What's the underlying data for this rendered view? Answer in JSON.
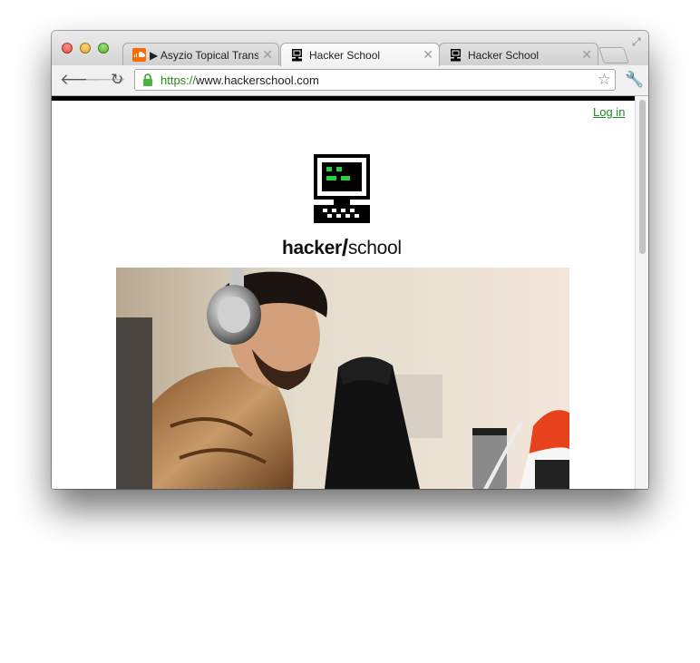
{
  "browser": {
    "tabs": [
      {
        "title": "Asyzio Topical Transl",
        "favicon": "soundcloud-icon",
        "playing": "▶",
        "active": false
      },
      {
        "title": "Hacker School",
        "favicon": "hacker-school-favicon",
        "active": true
      },
      {
        "title": "Hacker School",
        "favicon": "hacker-school-favicon",
        "active": false
      }
    ],
    "url_scheme": "https://",
    "url_host": "www.hackerschool.com"
  },
  "page": {
    "login_label": "Log in",
    "wordmark_part1": "hacker",
    "wordmark_slash": "/",
    "wordmark_part2": "school"
  },
  "colors": {
    "link": "#1f8a1f",
    "secure_scheme": "#2a8a1a",
    "logo_screen_green": "#1fd53a"
  }
}
